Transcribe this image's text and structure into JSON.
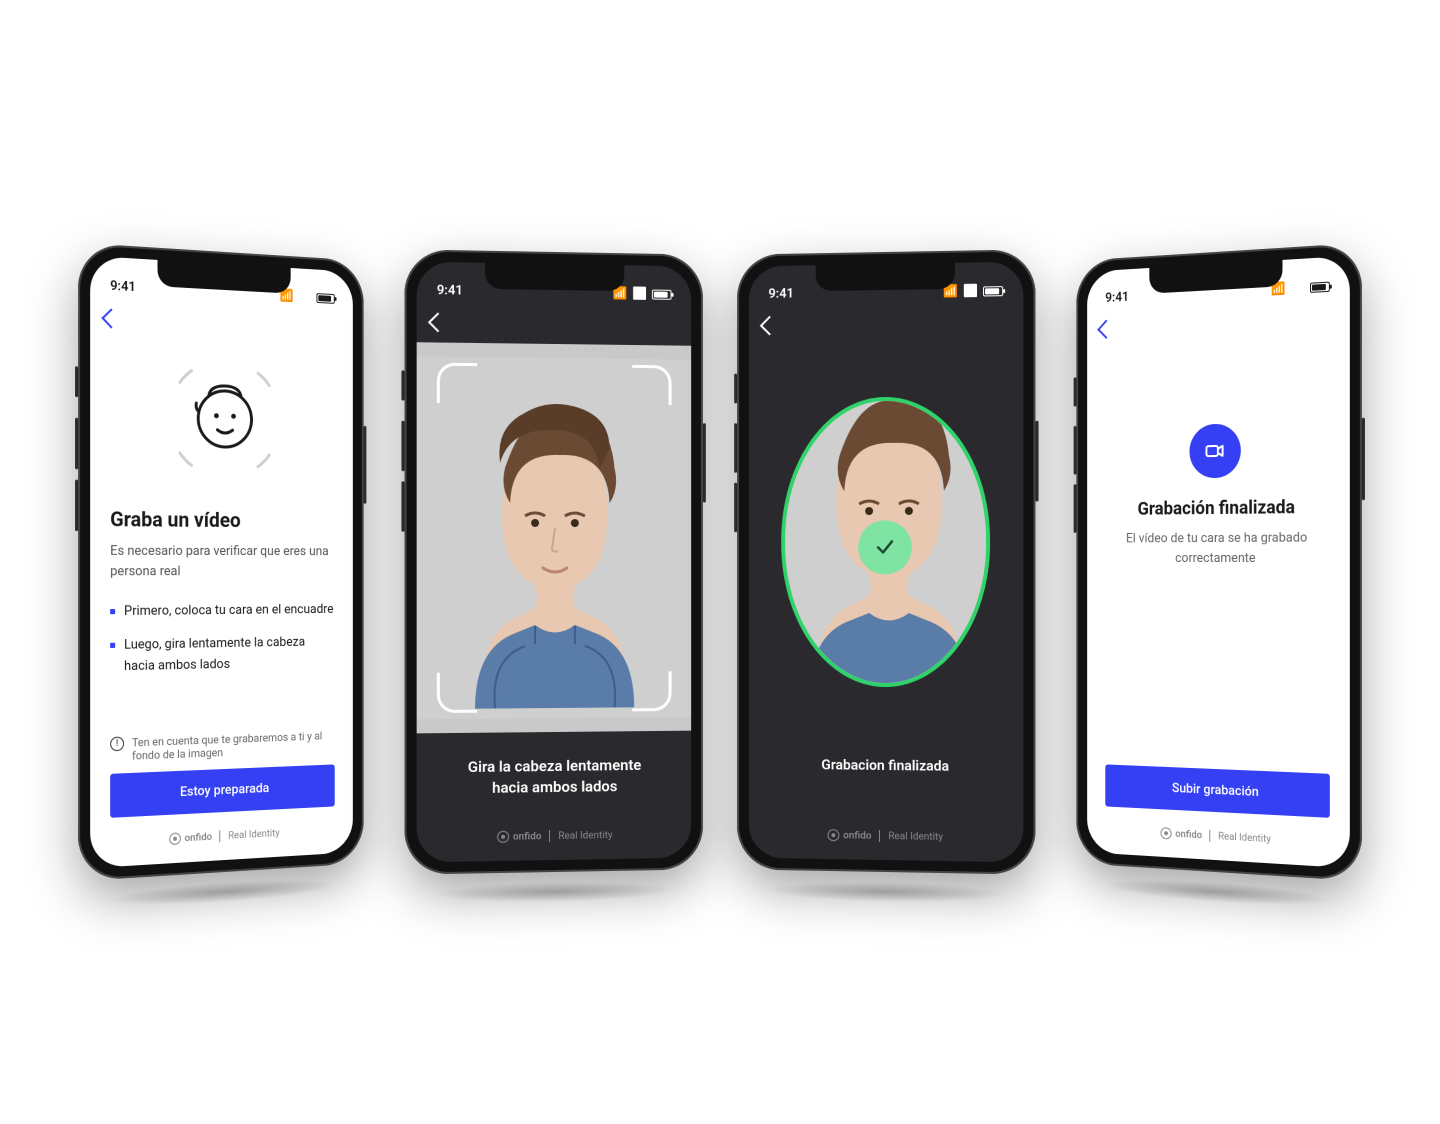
{
  "status_time": "9:41",
  "brand": "onfido",
  "brand_tagline": "Real Identity",
  "colors": {
    "primary": "#353FF4",
    "success": "#2fd36a"
  },
  "phone1": {
    "title": "Graba un vídeo",
    "subtitle": "Es necesario para verificar que eres una persona real",
    "bullet1": "Primero, coloca tu cara en el encuadre",
    "bullet2": "Luego, gira lentamente la cabeza hacia ambos lados",
    "notice": "Ten en cuenta que te grabaremos a ti y al fondo de la imagen",
    "cta": "Estoy preparada"
  },
  "phone2": {
    "instruction": "Gira la cabeza lentamente hacia ambos lados"
  },
  "phone3": {
    "status": "Grabacion finalizada"
  },
  "phone4": {
    "title": "Grabación finalizada",
    "subtitle": "El vídeo de tu cara se ha grabado correctamente",
    "cta": "Subir grabación"
  }
}
